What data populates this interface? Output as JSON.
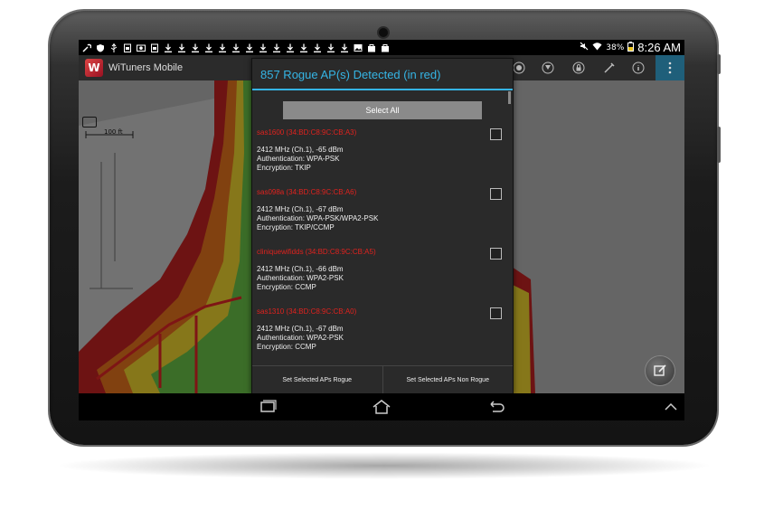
{
  "status_bar": {
    "battery": "38%",
    "time": "8:26 AM",
    "notification_icons": [
      "wrench-icon",
      "shield-icon",
      "usb-icon",
      "sim-icon",
      "screenshot-icon",
      "sim-icon",
      "download-icon",
      "download-icon",
      "download-icon",
      "download-icon",
      "download-icon",
      "download-icon",
      "download-icon",
      "download-icon",
      "download-icon",
      "download-icon",
      "download-icon",
      "download-icon",
      "download-icon",
      "download-icon",
      "image-icon",
      "bag-icon",
      "bag-icon"
    ]
  },
  "action_bar": {
    "app_title": "WiTuners Mobile"
  },
  "map": {
    "scale_label": "100 ft"
  },
  "dialog": {
    "title": "857 Rogue AP(s) Detected (in red)",
    "select_all": "Select All",
    "aps": [
      {
        "ssid": "sas1600 (34:BD:C8:9C:CB:A3)",
        "freq": "2412 MHz (Ch.1), -65 dBm",
        "auth": "Authentication: WPA-PSK",
        "enc": "Encryption: TKIP"
      },
      {
        "ssid": "sas098a (34:BD:C8:9C:CB:A6)",
        "freq": "2412 MHz (Ch.1), -67 dBm",
        "auth": "Authentication: WPA-PSK/WPA2-PSK",
        "enc": "Encryption: TKIP/CCMP"
      },
      {
        "ssid": "cliniquewifidds (34:BD:C8:9C:CB:A5)",
        "freq": "2412 MHz (Ch.1), -66 dBm",
        "auth": "Authentication: WPA2-PSK",
        "enc": "Encryption: CCMP"
      },
      {
        "ssid": "sas1310 (34:BD:C8:9C:CB:A0)",
        "freq": "2412 MHz (Ch.1), -67 dBm",
        "auth": "Authentication: WPA2-PSK",
        "enc": "Encryption: CCMP"
      }
    ],
    "btn_rogue": "Set Selected APs Rogue",
    "btn_non_rogue": "Set Selected APs Non Rogue"
  }
}
